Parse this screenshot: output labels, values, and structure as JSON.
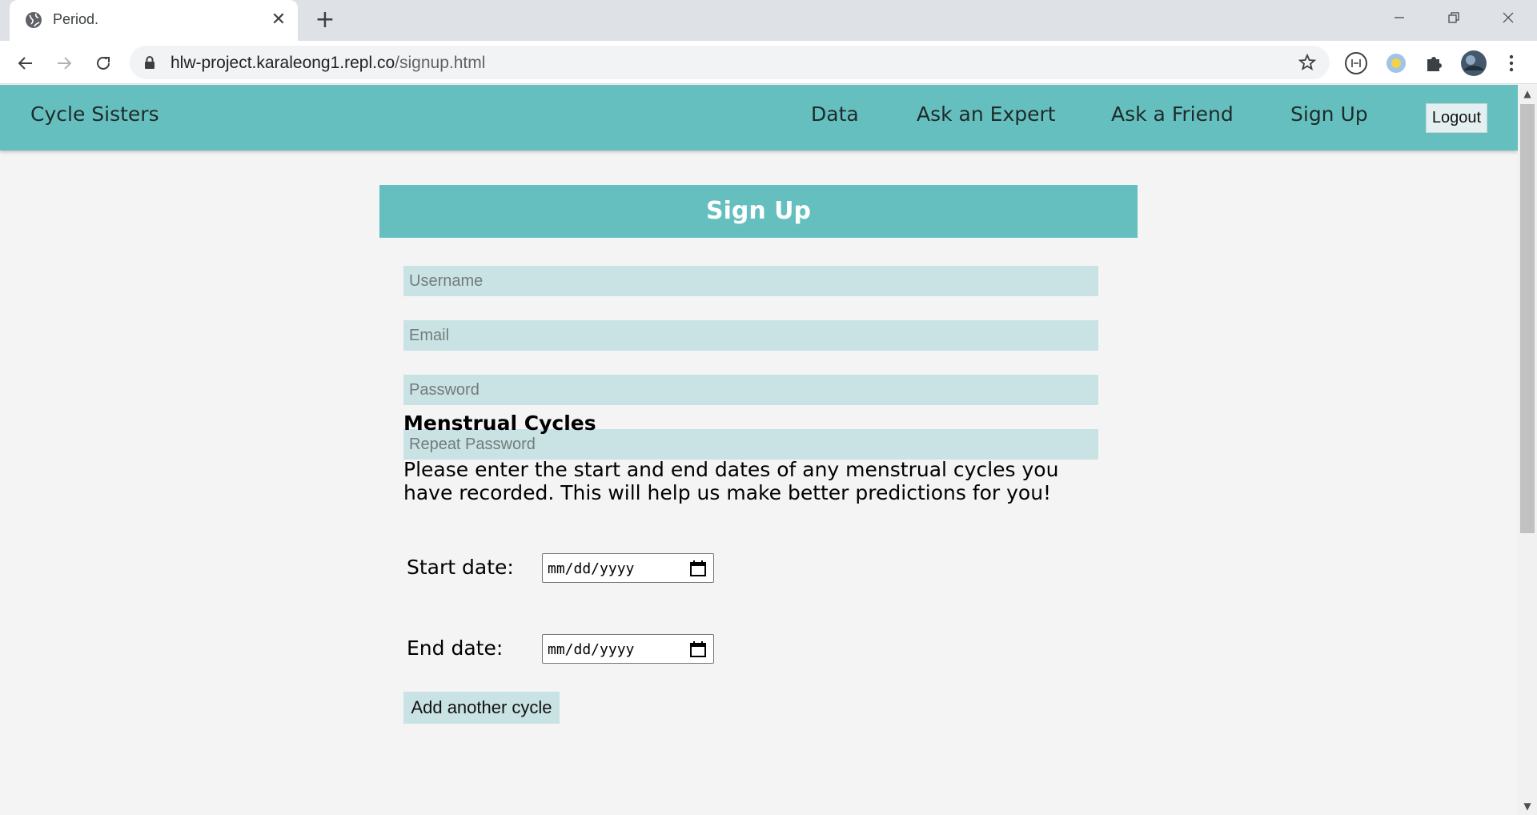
{
  "browser": {
    "tab_title": "Period.",
    "tab_close": "✕",
    "new_tab": "+",
    "url_host": "hlw-project.karaleong1.repl.co",
    "url_path": "/signup.html",
    "window_controls": [
      "minimize-icon",
      "restore-icon",
      "close-icon"
    ]
  },
  "navbar": {
    "brand": "Cycle Sisters",
    "links": [
      "Data",
      "Ask an Expert",
      "Ask a Friend",
      "Sign Up"
    ],
    "logout": "Logout",
    "color": "#66bfbf"
  },
  "form": {
    "title": "Sign Up",
    "placeholders": {
      "username": "Username",
      "email": "Email",
      "password": "Password",
      "repeat_password": "Repeat Password"
    },
    "cycles": {
      "title": "Menstrual Cycles",
      "description": "Please enter the start and end dates of any menstrual cycles you have recorded. This will help us make better predictions for you!",
      "start_label": "Start date:",
      "end_label": "End date:",
      "date_placeholder": "mm/dd/yyyy",
      "add_button": "Add another cycle"
    }
  },
  "colors": {
    "accent": "#66bfbf",
    "input_bg": "#c9e3e4",
    "page_bg": "#f3f4f3"
  }
}
